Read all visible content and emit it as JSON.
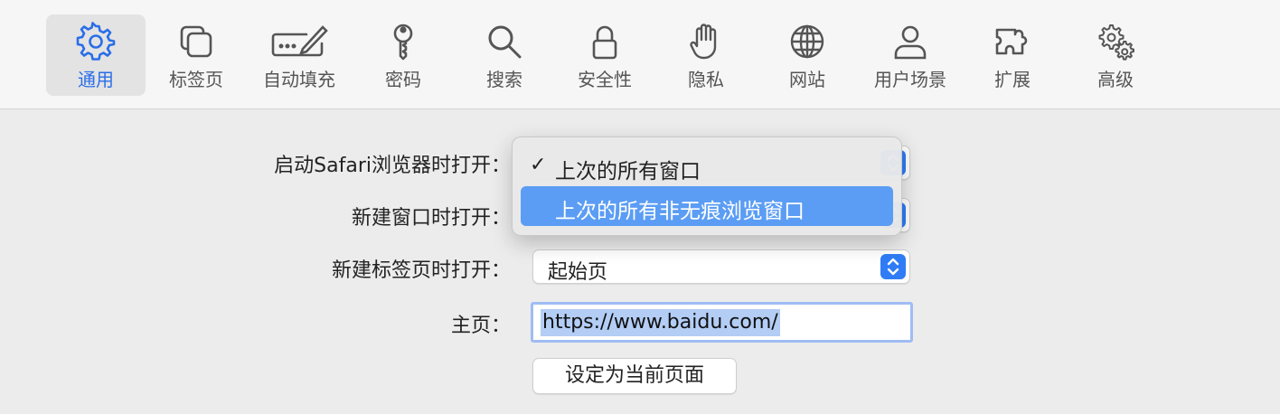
{
  "toolbar": {
    "tabs": [
      {
        "label": "通用",
        "icon": "gear-icon",
        "active": true
      },
      {
        "label": "标签页",
        "icon": "tabs-icon"
      },
      {
        "label": "自动填充",
        "icon": "pencil-field-icon"
      },
      {
        "label": "密码",
        "icon": "key-icon"
      },
      {
        "label": "搜索",
        "icon": "search-icon"
      },
      {
        "label": "安全性",
        "icon": "lock-icon"
      },
      {
        "label": "隐私",
        "icon": "hand-icon"
      },
      {
        "label": "网站",
        "icon": "globe-icon"
      },
      {
        "label": "用户场景",
        "icon": "person-icon"
      },
      {
        "label": "扩展",
        "icon": "puzzle-icon"
      },
      {
        "label": "高级",
        "icon": "gears-icon"
      }
    ]
  },
  "settings": {
    "launch_label": "启动Safari浏览器时打开：",
    "new_window_label": "新建窗口时打开：",
    "new_tab_label": "新建标签页时打开：",
    "new_tab_value": "起始页",
    "homepage_label": "主页：",
    "homepage_value": "https://www.baidu.com/",
    "set_current_button": "设定为当前页面"
  },
  "popup": {
    "items": [
      {
        "label": "上次的所有窗口",
        "checked": true
      },
      {
        "label": "上次的所有非无痕浏览窗口",
        "highlighted": true
      }
    ]
  },
  "colors": {
    "accent": "#2a6ee8",
    "highlight": "#5b9df4",
    "selection": "#b3cdf5"
  }
}
